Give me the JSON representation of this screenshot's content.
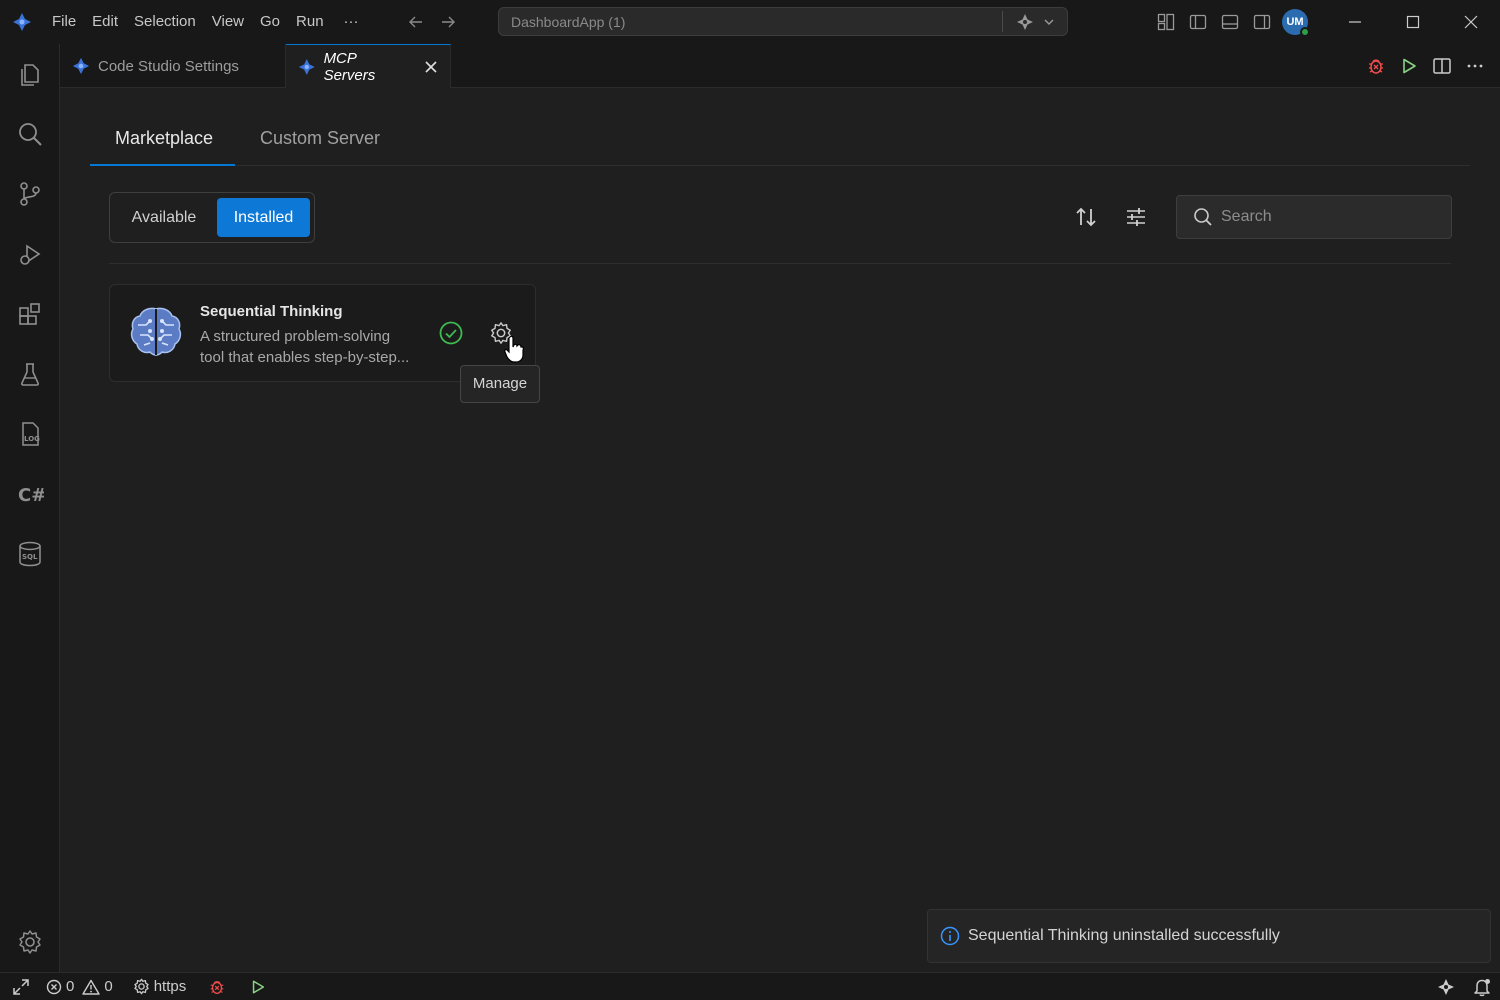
{
  "menu": [
    "File",
    "Edit",
    "Selection",
    "View",
    "Go",
    "Run"
  ],
  "menu_more": "···",
  "command_center": {
    "text": "DashboardApp (1)"
  },
  "account": {
    "initials": "UM"
  },
  "tabs": [
    {
      "label": "Code Studio Settings",
      "active": false
    },
    {
      "label": "MCP Servers",
      "active": true
    }
  ],
  "main_tabs": [
    "Marketplace",
    "Custom Server"
  ],
  "filter": {
    "available": "Available",
    "installed": "Installed",
    "selected": "Installed"
  },
  "search": {
    "placeholder": "Search",
    "value": ""
  },
  "server": {
    "name": "Sequential Thinking",
    "description_line1": "A structured problem-solving",
    "description_line2": "tool that enables step-by-step..."
  },
  "tooltip": "Manage",
  "toast": "Sequential Thinking uninstalled successfully",
  "statusbar": {
    "errors": "0",
    "warnings": "0",
    "branch": "https"
  },
  "colors": {
    "accent": "#0078d4",
    "installed_button": "#0e78d6",
    "success": "#3fb950",
    "debug": "#f14c4c",
    "run": "#89d185"
  }
}
